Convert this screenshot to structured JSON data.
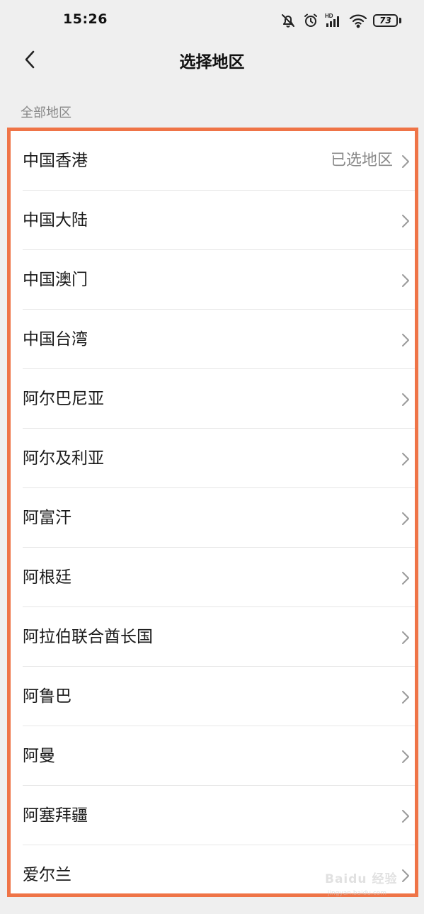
{
  "status_bar": {
    "time": "15:26",
    "battery_level": "73",
    "icons": [
      "mute-icon",
      "alarm-icon",
      "hd-signal-icon",
      "wifi-icon",
      "battery-icon"
    ]
  },
  "header": {
    "back_icon": "chevron-left-icon",
    "title": "选择地区"
  },
  "section": {
    "label": "全部地区"
  },
  "regions": [
    {
      "name": "中国香港",
      "status": "已选地区"
    },
    {
      "name": "中国大陆",
      "status": ""
    },
    {
      "name": "中国澳门",
      "status": ""
    },
    {
      "name": "中国台湾",
      "status": ""
    },
    {
      "name": "阿尔巴尼亚",
      "status": ""
    },
    {
      "name": "阿尔及利亚",
      "status": ""
    },
    {
      "name": "阿富汗",
      "status": ""
    },
    {
      "name": "阿根廷",
      "status": ""
    },
    {
      "name": "阿拉伯联合酋长国",
      "status": ""
    },
    {
      "name": "阿鲁巴",
      "status": ""
    },
    {
      "name": "阿曼",
      "status": ""
    },
    {
      "name": "阿塞拜疆",
      "status": ""
    },
    {
      "name": "爱尔兰",
      "status": ""
    }
  ],
  "colors": {
    "highlight_border": "#ef7447",
    "background": "#efefef",
    "secondary_text": "#8a8a8a"
  },
  "watermark": {
    "text": "Baidu 经验",
    "sub": "jingyan.baidu.com"
  }
}
